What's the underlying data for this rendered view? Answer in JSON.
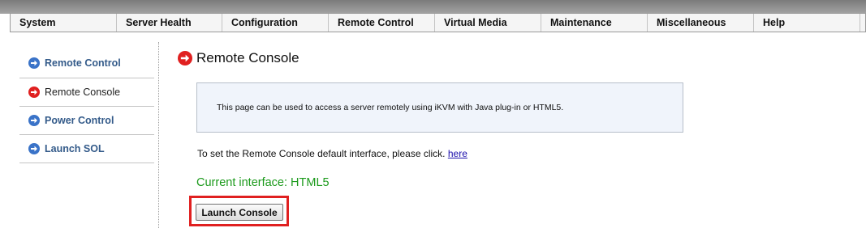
{
  "menu": [
    {
      "label": "System"
    },
    {
      "label": "Server Health"
    },
    {
      "label": "Configuration"
    },
    {
      "label": "Remote Control"
    },
    {
      "label": "Virtual Media"
    },
    {
      "label": "Maintenance"
    },
    {
      "label": "Miscellaneous"
    },
    {
      "label": "Help"
    }
  ],
  "sidebar": {
    "items": [
      {
        "label": "Remote Control",
        "icon": "arrow-right-circle-icon",
        "color": "#3a73c8"
      },
      {
        "label": "Remote Console",
        "icon": "arrow-right-circle-icon",
        "color": "#e02020",
        "active": true
      },
      {
        "label": "Power Control",
        "icon": "arrow-right-circle-icon",
        "color": "#3a73c8"
      },
      {
        "label": "Launch SOL",
        "icon": "arrow-right-circle-icon",
        "color": "#3a73c8"
      }
    ]
  },
  "main": {
    "title": "Remote Console",
    "title_icon_color": "#e02020",
    "info": "This page can be used to access a server remotely using iKVM with Java plug-in or HTML5.",
    "set_default_text": "To set the Remote Console default interface, please click.",
    "here_link": "here",
    "current_interface": "Current interface: HTML5",
    "launch_button": "Launch Console"
  },
  "colors": {
    "accent_red": "#e02020",
    "accent_blue": "#3a73c8",
    "status_green": "#1c9a1c"
  }
}
